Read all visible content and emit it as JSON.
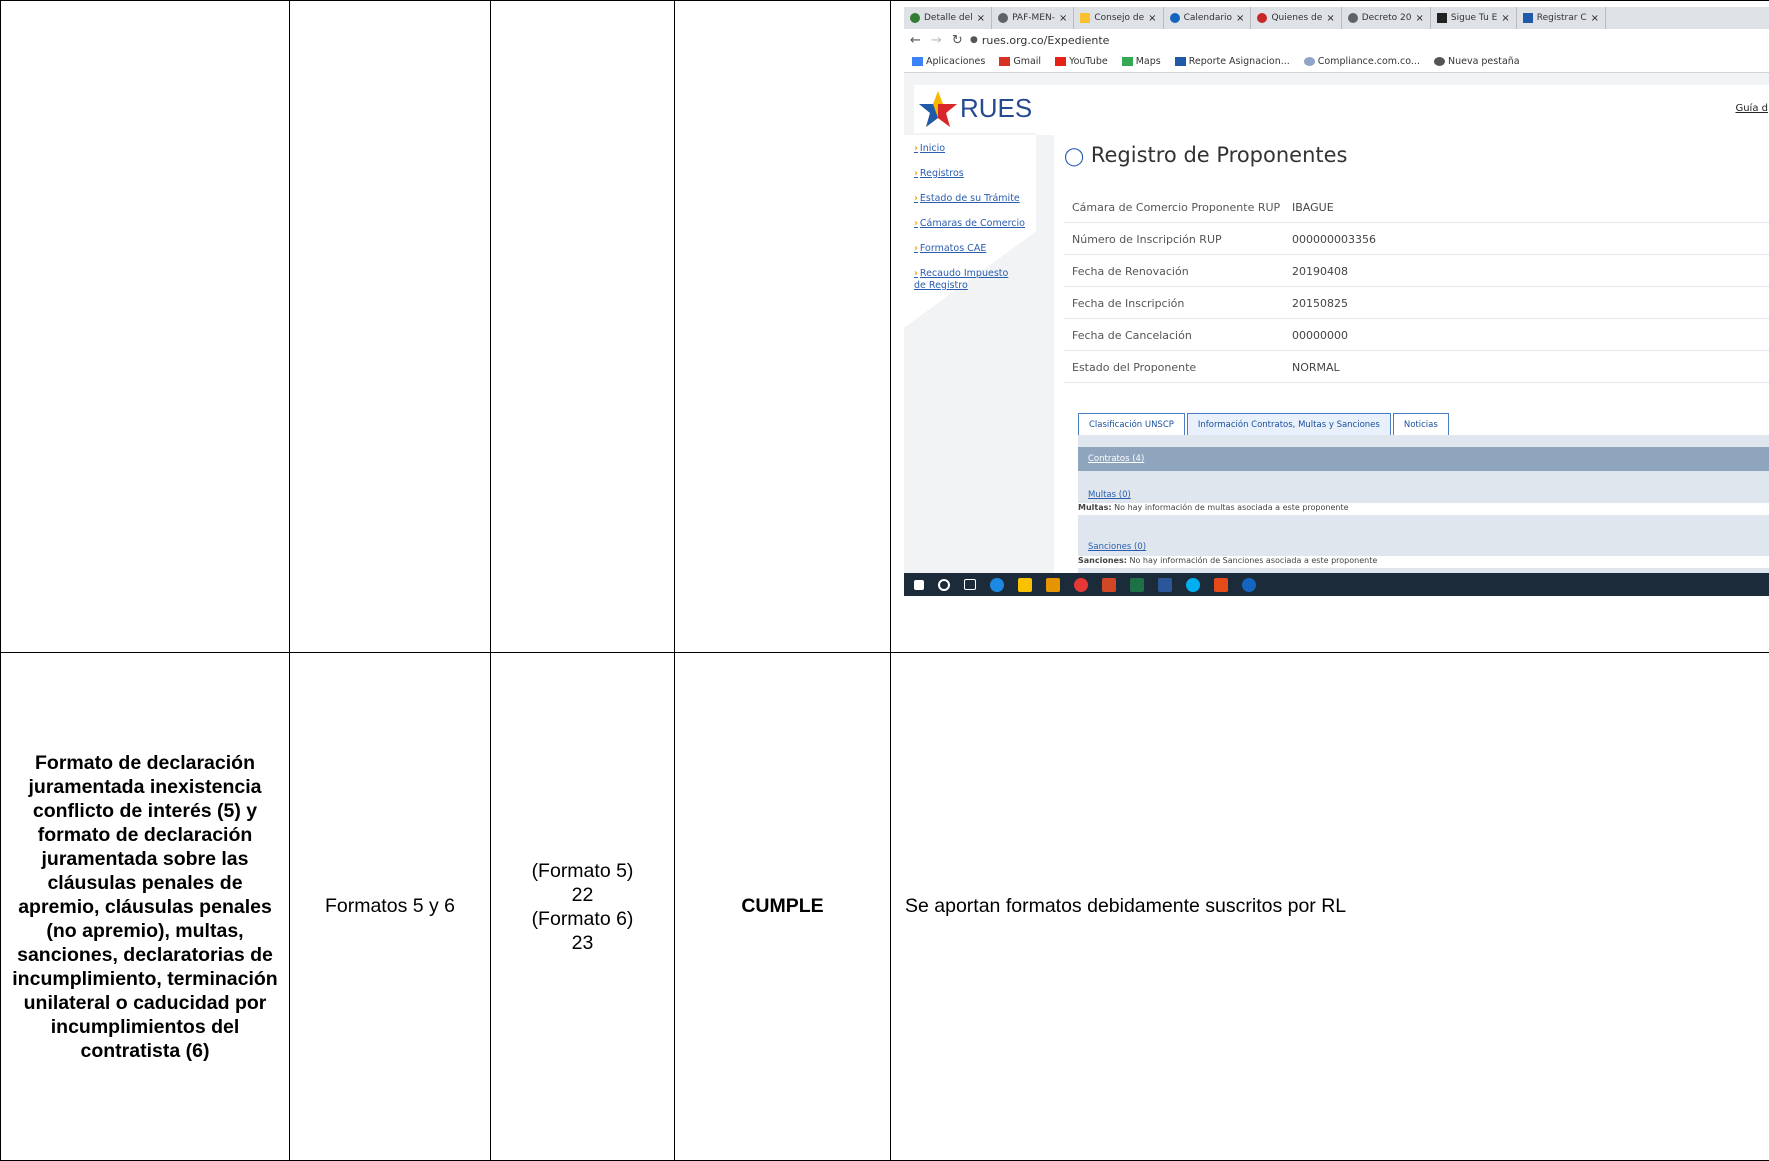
{
  "screenshot": {
    "browser_tabs": [
      "Detalle del",
      "PAF-MEN-",
      "Consejo de",
      "Calendario",
      "Quienes de",
      "Decreto 20",
      "Sigue Tu E",
      "Registrar C"
    ],
    "tab_close": "×",
    "address": "rues.org.co/Expediente",
    "bookmarks": [
      "Aplicaciones",
      "Gmail",
      "YouTube",
      "Maps",
      "Reporte Asignacion...",
      "Compliance.com.co...",
      "Nueva pestaña"
    ],
    "logo_text": "RUES",
    "top_link": "Guía d",
    "menu": [
      "Inicio",
      "Registros",
      "Estado de su Trámite",
      "Cámaras de Comercio",
      "Formatos CAE",
      "Recaudo Impuesto de Registro"
    ],
    "panel_title": "Registro de Proponentes",
    "fields": [
      {
        "label": "Cámara de Comercio Proponente RUP",
        "value": "IBAGUE"
      },
      {
        "label": "Número de Inscripción RUP",
        "value": "000000003356"
      },
      {
        "label": "Fecha de Renovación",
        "value": "20190408"
      },
      {
        "label": "Fecha de Inscripción",
        "value": "20150825"
      },
      {
        "label": "Fecha de Cancelación",
        "value": "00000000"
      },
      {
        "label": "Estado del Proponente",
        "value": "NORMAL"
      }
    ],
    "tabs": [
      "Clasificación UNSCP",
      "Información Contratos, Multas y Sanciones",
      "Noticias"
    ],
    "contratos_link": "Contratos (4)",
    "multas_link": "Multas (0)",
    "multas_note_label": "Multas:",
    "multas_note": "No hay información de multas asociada a este proponente",
    "sanciones_link": "Sanciones (0)",
    "sanciones_note_label": "Sanciones:",
    "sanciones_note": "No hay información de Sanciones asociada a este proponente"
  },
  "row2": {
    "criterio": "Formato de declaración juramentada inexistencia conflicto de interés (5) y formato de declaración juramentada sobre las cláusulas penales de apremio, cláusulas penales (no apremio), multas, sanciones, declaratorias de incumplimiento, terminación unilateral o caducidad por incumplimientos del contratista (6)",
    "documentos": "Formatos  5 y 6",
    "folio_lines": [
      "(Formato 5)",
      "22",
      "(Formato 6)",
      "23"
    ],
    "estado": "CUMPLE",
    "observacion": "Se aportan formatos debidamente suscritos por RL"
  }
}
